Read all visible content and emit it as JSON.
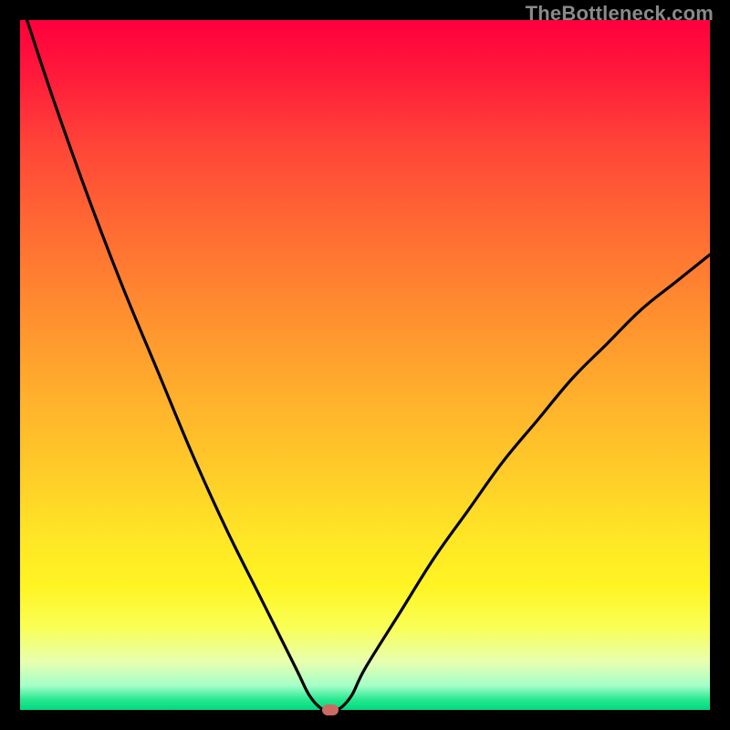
{
  "watermark": {
    "text": "TheBottleneck.com"
  },
  "colors": {
    "frame_bg": "#000000",
    "gradient_top": "#ff003c",
    "gradient_bottom": "#00d982",
    "curve": "#000000",
    "marker": "#cc6b63",
    "watermark": "#8a8a8a"
  },
  "chart_data": {
    "type": "line",
    "title": "",
    "xlabel": "",
    "ylabel": "",
    "xlim": [
      0,
      100
    ],
    "ylim": [
      0,
      100
    ],
    "grid": false,
    "legend": false,
    "series": [
      {
        "name": "bottleneck-curve",
        "x": [
          1,
          5,
          10,
          15,
          20,
          25,
          30,
          35,
          40,
          42,
          44,
          46,
          48,
          50,
          55,
          60,
          65,
          70,
          75,
          80,
          85,
          90,
          95,
          100
        ],
        "values": [
          100,
          88,
          74,
          61,
          49,
          37,
          26,
          16,
          6,
          2,
          0,
          0,
          2,
          6,
          14,
          22,
          29,
          36,
          42,
          48,
          53,
          58,
          62,
          66
        ]
      }
    ],
    "annotations": [
      {
        "name": "optimal-point",
        "x": 45,
        "y": 0
      }
    ]
  }
}
